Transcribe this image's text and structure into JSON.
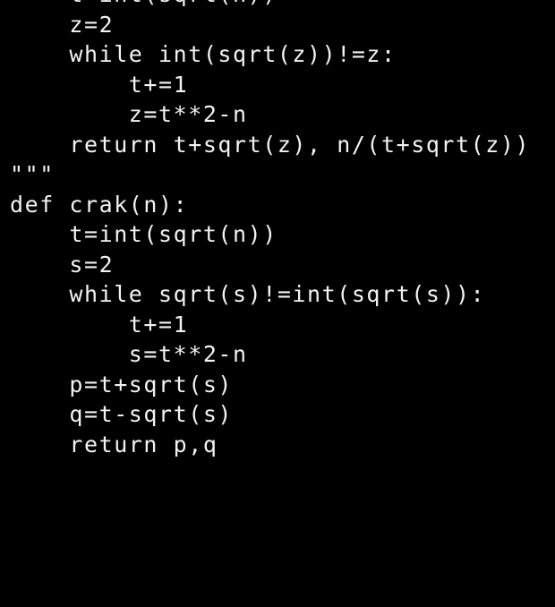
{
  "editor": {
    "background": "#000000",
    "text_color": "#f2f2f2",
    "lines": [
      "    t=int(sqrt(n))",
      "    z=2",
      "    while int(sqrt(z))!=z:",
      "        t+=1",
      "        z=t**2-n",
      "    return t+sqrt(z), n/(t+sqrt(z))",
      "\"\"\"",
      "def crak(n):",
      "    t=int(sqrt(n))",
      "    s=2",
      "    while sqrt(s)!=int(sqrt(s)):",
      "        t+=1",
      "        s=t**2-n",
      "    p=t+sqrt(s)",
      "    q=t-sqrt(s)",
      "    return p,q"
    ]
  }
}
